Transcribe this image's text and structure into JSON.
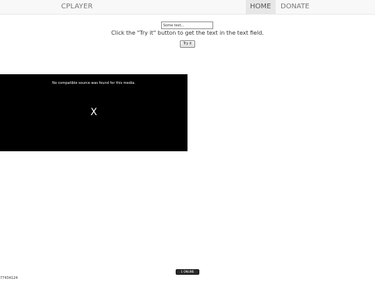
{
  "navbar": {
    "brand": "CPLAYER",
    "items": [
      {
        "label": "HOME",
        "active": true
      },
      {
        "label": "DONATE",
        "active": false
      }
    ]
  },
  "form": {
    "text_field_value": "Some text...",
    "instruction": "Click the \"Try it\" button to get the text in the text field.",
    "button_label": "Try it"
  },
  "player": {
    "error_message": "No compatible source was found for this media.",
    "close_label": "X"
  },
  "status": {
    "online_badge": "1 ONLINE"
  },
  "footer": {
    "number": "77434124"
  },
  "colors": {
    "navbar_bg": "#f8f8f8",
    "active_nav_bg": "#e7e7e7",
    "player_bg": "#000000",
    "badge_bg": "#2b2b2b"
  }
}
